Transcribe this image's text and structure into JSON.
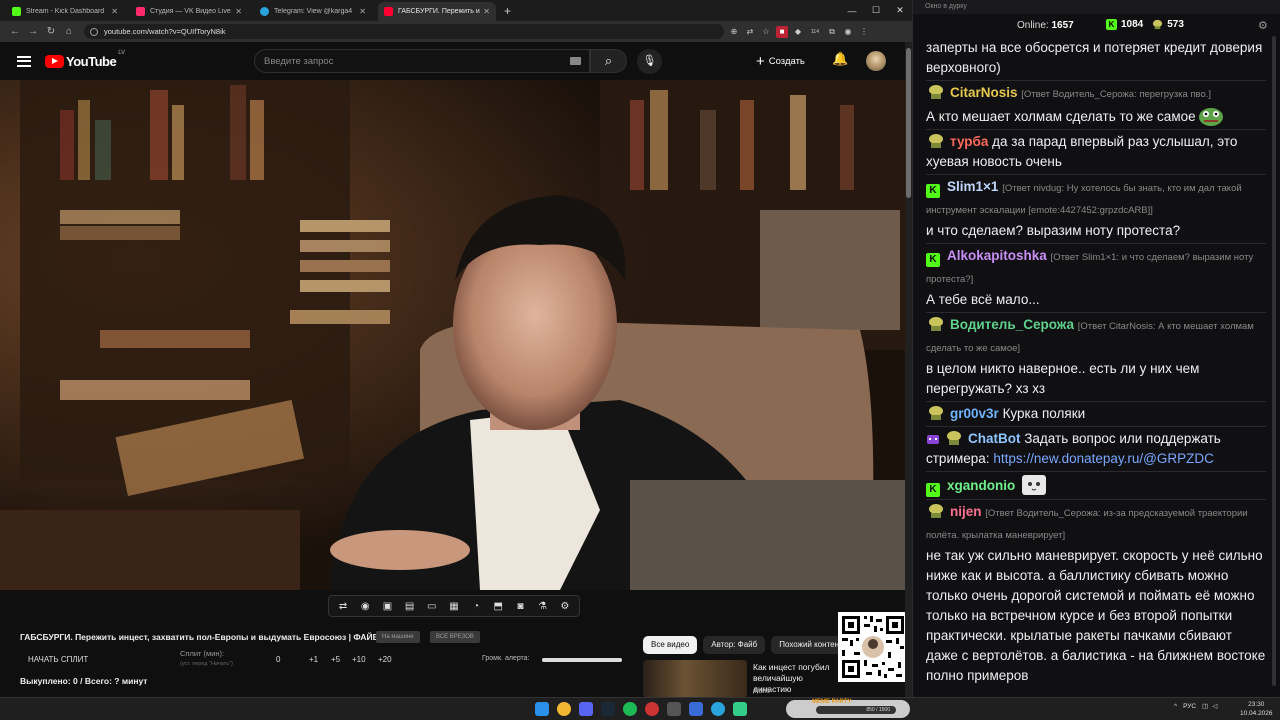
{
  "browser": {
    "tabs": [
      {
        "title": "Stream - Kick Dashboard",
        "icon": "kick-icon",
        "color": "#53fc18"
      },
      {
        "title": "Студия — VK Видео Live",
        "icon": "vk-video-icon",
        "color": "#ff2a6a"
      },
      {
        "title": "Telegram: View @karga4",
        "icon": "telegram-icon",
        "color": "#2aa3dd"
      },
      {
        "title": "ГАБСБУРГИ. Пережить инцест",
        "icon": "youtube-icon",
        "color": "#ff0033"
      }
    ],
    "url": "youtube.com/watch?v=QUIfToryN8ik",
    "ext_badge": "114"
  },
  "youtube": {
    "logo": "YouTube",
    "region": "LV",
    "search_placeholder": "Введите запрос",
    "create_label": "Создать"
  },
  "video": {
    "title": "ГАБСБУРГИ. Пережить инцест, захватить пол-Европы и выдумать Евросоюз | ФАЙБ",
    "chip1": "На машине",
    "chip2": "ВСЕ ВРЕЗОВ",
    "split_button": "НАЧАТЬ СПЛИТ",
    "split_label": "Сплит (мин):",
    "split_sub": "(уст. перед \"Начать\")",
    "split_values": [
      "0",
      "+1",
      "+5",
      "+10",
      "+20"
    ],
    "alert_label": "Громк. алерта:",
    "alert_volume": 1.0,
    "bought": "Выкуплено: 0 / Всего: ? минут"
  },
  "recs": {
    "chips": [
      "Все видео",
      "Автор: Файб",
      "Похожий контент"
    ],
    "item_title": "Как инцест погубил величайшую династию",
    "item_channel": "Файб"
  },
  "taskbar": {
    "meme_label": "MEME PARTY",
    "meme_progress": "850 / 1500",
    "lang": "РУС",
    "time": "23:30",
    "date": "10.04.2026"
  },
  "chat": {
    "window_title": "Окно в дурку",
    "online_label": "Online:",
    "online_count": "1657",
    "kick_count": "1084",
    "goose_count": "573",
    "messages": [
      {
        "text": "заперты на все обосрется и потеряет кредит доверия верховного)"
      },
      {
        "user": "CitarNosis",
        "color": "#e6c84f",
        "badge": "goose",
        "reply": "[Ответ Водитель_Серожа: перегрузка пво.]",
        "text": "А кто мешает холмам сделать то же самое"
      },
      {
        "user": "турба",
        "color": "#ff6a5c",
        "badge": "goose",
        "text": "да за парад впервый раз услышал, это хуевая новость очень"
      },
      {
        "user": "Slim1×1",
        "color": "#bfd6ff",
        "badge": "kick",
        "reply": "[Ответ nivdug: Ну хотелось бы знать, кто им дал такой инструмент эскалации [emote:4427452:grpzdcARB]]",
        "text": "и что сделаем? выразим ноту протеста?"
      },
      {
        "user": "Alkokapitoshka",
        "color": "#c98ff5",
        "badge": "kick",
        "reply": "[Ответ Slim1×1: и что сделаем? выразим ноту протеста?]",
        "text": "А тебе всё мало..."
      },
      {
        "user": "Водитель_Серожа",
        "color": "#5fd18c",
        "badge": "goose",
        "reply": "[Ответ CitarNosis: А кто мешает холмам сделать то же самое]",
        "text": "в целом никто наверное.. есть ли у них чем перегружать? хз хз"
      },
      {
        "user": "gr00v3r",
        "color": "#6fb6ff",
        "badge": "goose",
        "text": "Курка поляки"
      },
      {
        "user": "ChatBot",
        "color": "#8ec5ff",
        "badge": "bot",
        "text": "Задать вопрос или поддержать стримера:",
        "link": "https://new.donatepay.ru/@GRPZDC"
      },
      {
        "user": "xgandonio",
        "color": "#6ff08a",
        "badge": "kick",
        "text": ""
      },
      {
        "user": "nijen",
        "color": "#ff6f8e",
        "badge": "goose",
        "reply": "[Ответ Водитель_Серожа: из-за предсказуемой траектории полёта. крылатка маневрирует]",
        "text": "не так уж сильно маневрирует. скорость у неё сильно ниже как и высота. а баллистику сбивать можно только очень дорогой системой и поймать её можно только на встречном курсе и без второй попытки практически. крылатые ракеты пачками сбивают даже с вертолётов. а балистика - на ближнем востоке полно примеров"
      }
    ]
  }
}
